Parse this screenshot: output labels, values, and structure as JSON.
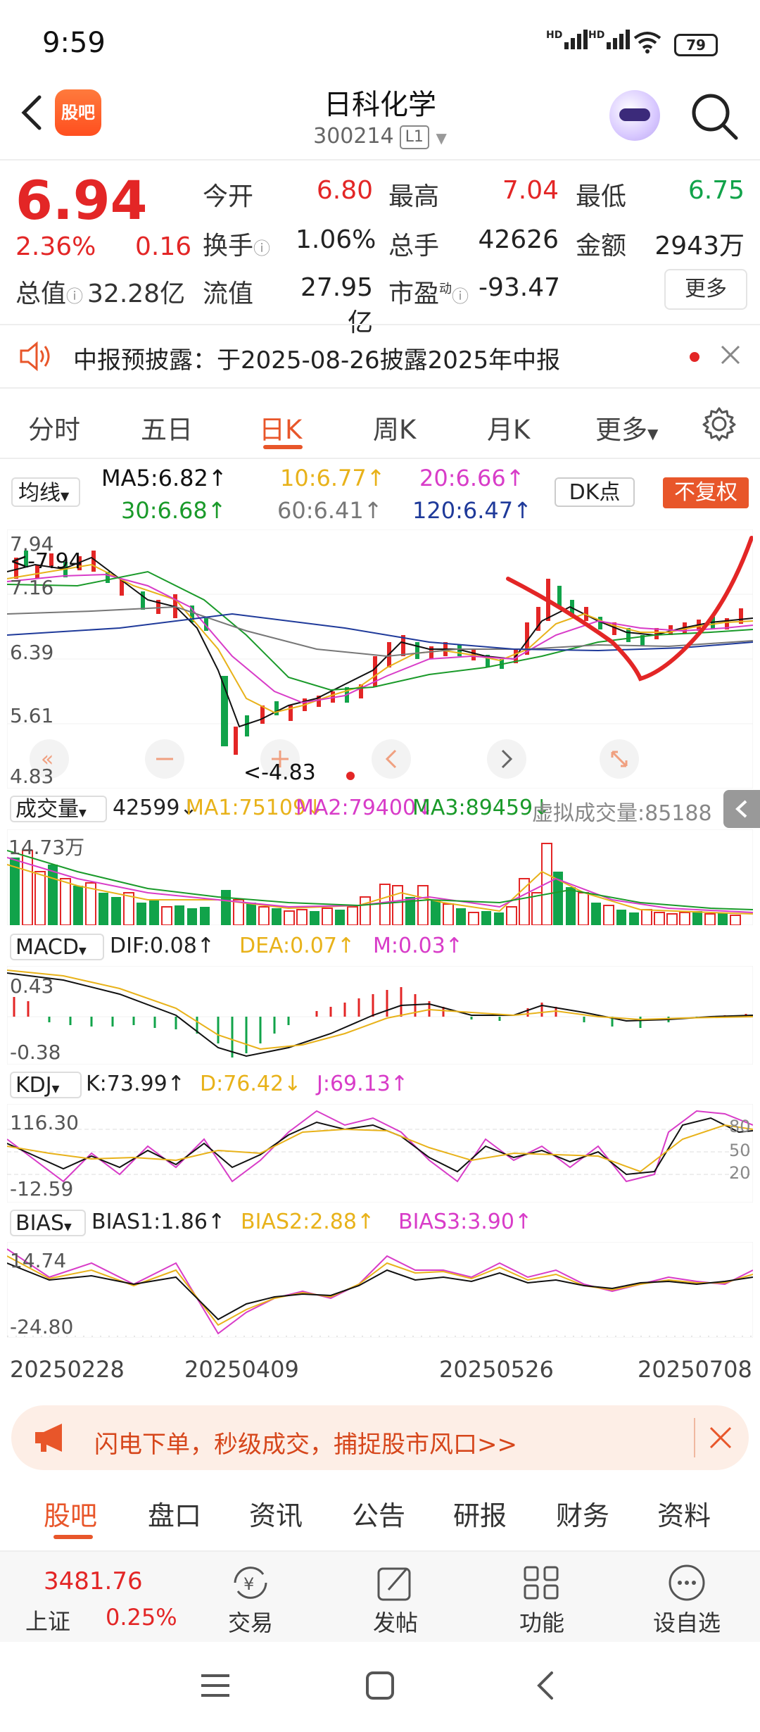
{
  "status": {
    "time": "9:59",
    "battery": "79"
  },
  "header": {
    "title": "日科化学",
    "code": "300214",
    "board": "L1",
    "logo_text": "股吧"
  },
  "quote": {
    "price": "6.94",
    "pct": "2.36%",
    "change": "0.16",
    "rows": [
      [
        {
          "label": "今开",
          "value": "6.80",
          "color": "red"
        },
        {
          "label": "最高",
          "value": "7.04",
          "color": "red"
        },
        {
          "label": "最低",
          "value": "6.75",
          "color": "green"
        }
      ],
      [
        {
          "label": "换手",
          "value": "1.06%",
          "color": "dark"
        },
        {
          "label": "总手",
          "value": "42626",
          "color": "dark"
        },
        {
          "label": "金额",
          "value": "2943万",
          "color": "dark"
        }
      ],
      [
        {
          "label": "流值",
          "value": "27.95亿",
          "color": "dark"
        },
        {
          "label": "市盈",
          "value": "-93.47",
          "color": "dark"
        }
      ]
    ],
    "total_label": "总值",
    "total_value": "32.28亿",
    "pe_super": "动",
    "more": "更多"
  },
  "notice": {
    "text": "中报预披露：于2025-08-26披露2025年中报"
  },
  "tabs": {
    "items": [
      "分时",
      "五日",
      "日K",
      "周K",
      "月K",
      "更多"
    ],
    "active": "日K"
  },
  "ma": {
    "selector": "均线",
    "ma5": "MA5:6.82↑",
    "ma10": "10:6.77↑",
    "ma20": "20:6.66↑",
    "ma30": "30:6.68↑",
    "ma60": "60:6.41↑",
    "ma120": "120:6.47↑",
    "dk": "DK点",
    "fq": "不复权"
  },
  "kchart": {
    "y_labels": [
      "7.94",
      "7.16",
      "6.39",
      "5.61",
      "4.83"
    ],
    "high_marker": "<-7.94",
    "low_marker": "<-4.83"
  },
  "volume": {
    "selector": "成交量",
    "cur": "42599↓",
    "ma1": "MA1:75109↓",
    "ma2": "MA2:79400↓",
    "ma3": "MA3:89459↓",
    "virtual": "虚拟成交量:85188",
    "ymax": "14.73万"
  },
  "macd": {
    "selector": "MACD",
    "dif": "DIF:0.08↑",
    "dea": "DEA:0.07↑",
    "m": "M:0.03↑",
    "ymax": "0.43",
    "ymin": "-0.38"
  },
  "kdj": {
    "selector": "KDJ",
    "k": "K:73.99↑",
    "d": "D:76.42↓",
    "j": "J:69.13↑",
    "ymax": "116.30",
    "ymin": "-12.59",
    "r80": "80",
    "r50": "50",
    "r20": "20"
  },
  "bias": {
    "selector": "BIAS",
    "b1": "BIAS1:1.86↑",
    "b2": "BIAS2:2.88↑",
    "b3": "BIAS3:3.90↑",
    "ymax": "14.74",
    "ymin": "-24.80"
  },
  "dates": [
    "20250228",
    "20250409",
    "20250526",
    "20250708"
  ],
  "ad": {
    "text": "闪电下单，秒级成交，捕捉股市风口>>"
  },
  "bottom_tabs": {
    "items": [
      "股吧",
      "盘口",
      "资讯",
      "公告",
      "研报",
      "财务",
      "资料"
    ],
    "active": "股吧"
  },
  "footer": {
    "index_value": "3481.76",
    "index_name": "上证",
    "index_pct": "0.25%",
    "items": [
      "交易",
      "发帖",
      "功能",
      "设自选"
    ]
  },
  "colors": {
    "accent": "#e8562a",
    "up": "#e32626",
    "down": "#11a34a",
    "ma5": "#111111",
    "ma10": "#e8b21a",
    "ma20": "#d83cc8",
    "ma30": "#1a9a2a",
    "ma60": "#777777",
    "ma120": "#1f3a9a"
  }
}
